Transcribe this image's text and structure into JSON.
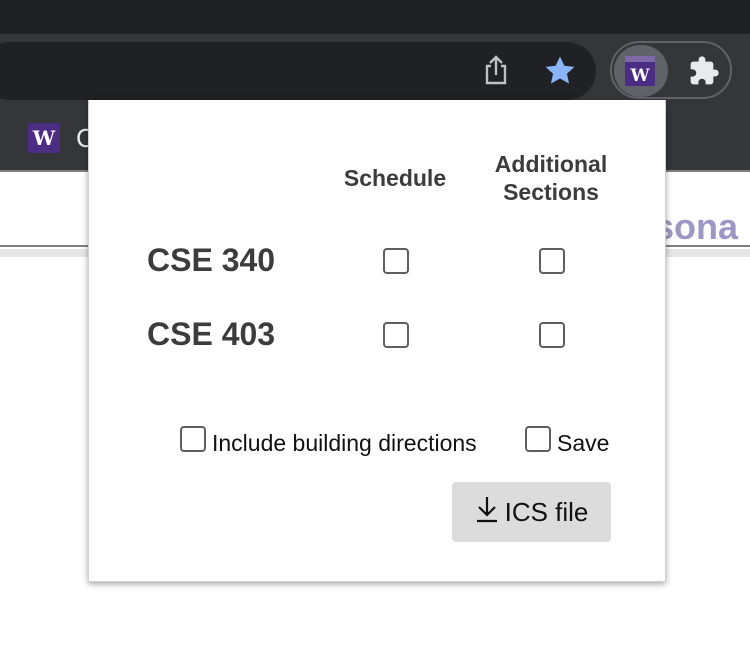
{
  "browser": {
    "bookmark": {
      "favicon_letter": "W",
      "label": "C"
    },
    "page_peek_text": "rsona",
    "icons": [
      "share-icon",
      "star-icon",
      "uw-extension-icon",
      "puzzle-icon"
    ],
    "colors": {
      "star": "#8ab4f8",
      "uw_purple": "#4b2e83",
      "chrome_dark": "#35363a"
    }
  },
  "popup": {
    "columns": {
      "schedule": "Schedule",
      "additional_line1": "Additional",
      "additional_line2": "Sections"
    },
    "courses": [
      {
        "name": "CSE 340",
        "schedule_checked": false,
        "additional_checked": false
      },
      {
        "name": "CSE 403",
        "schedule_checked": false,
        "additional_checked": false
      }
    ],
    "options": {
      "include_directions": {
        "label": "Include building directions",
        "checked": false
      },
      "save": {
        "label": "Save",
        "checked": false
      }
    },
    "download_button": {
      "label": "ICS file",
      "icon": "download-icon"
    }
  }
}
